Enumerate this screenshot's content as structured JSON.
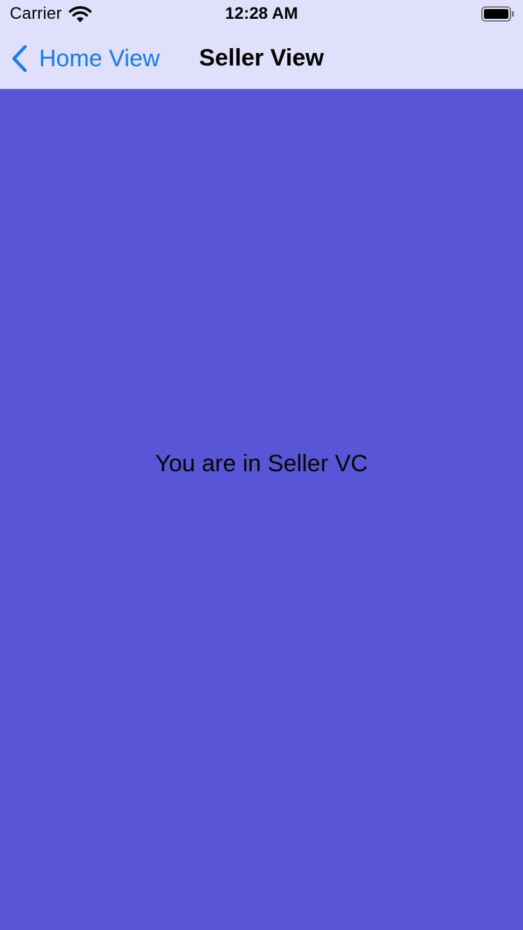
{
  "status_bar": {
    "carrier": "Carrier",
    "time": "12:28 AM",
    "wifi_icon": "wifi-icon",
    "battery_icon": "battery-icon"
  },
  "nav": {
    "back_label": "Home View",
    "back_icon": "chevron-left-icon",
    "title": "Seller View"
  },
  "content": {
    "message": "You are in Seller VC"
  },
  "colors": {
    "background": "#5856d6",
    "nav_background": "#e0e0fc",
    "accent": "#157cf7"
  }
}
